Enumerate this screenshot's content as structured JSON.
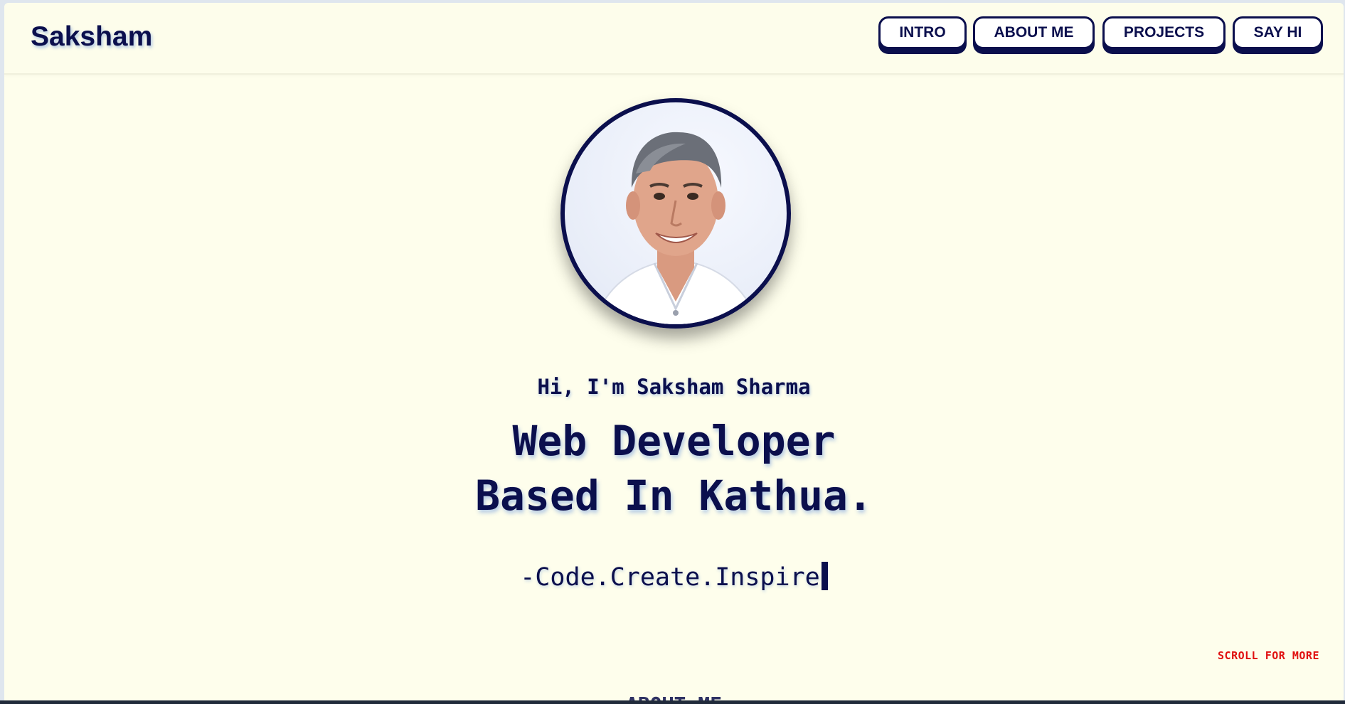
{
  "header": {
    "brand": "Saksham",
    "nav": [
      "INTRO",
      "ABOUT ME",
      "PROJECTS",
      "SAY HI"
    ]
  },
  "hero": {
    "greeting": "Hi, I'm Saksham Sharma",
    "headline_line1": "Web Developer",
    "headline_line2": "Based In Kathua.",
    "tagline": "-Code.Create.Inspire"
  },
  "scroll_hint": "SCROLL FOR MORE",
  "next_section_title": "ABOUT ME",
  "colors": {
    "background": "#fefeec",
    "primary": "#0b0f4d",
    "scroll_hint": "#e01010",
    "button_bg": "#ffffff"
  },
  "icons": {
    "avatar": "profile-photo"
  }
}
